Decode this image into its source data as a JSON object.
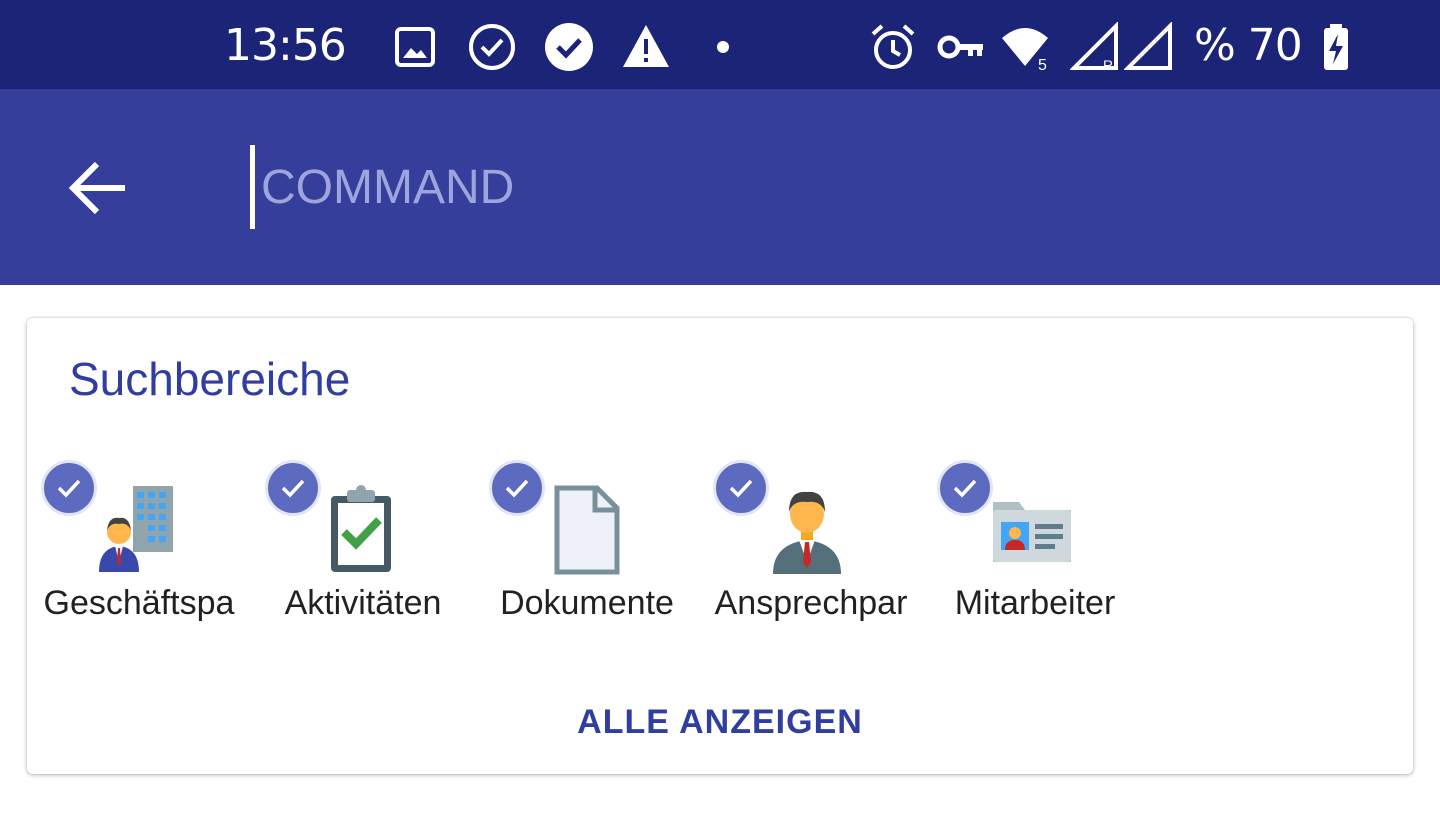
{
  "status_bar": {
    "time": "13:56",
    "battery_percent_text": "% 70",
    "icons_left": [
      "image-icon",
      "check-circle-outline-icon",
      "check-circle-filled-icon",
      "warning-icon",
      "dot-icon"
    ],
    "icons_right": [
      "alarm-icon",
      "vpn-key-icon",
      "wifi-5-icon",
      "signal-roaming-icon",
      "signal-icon",
      "battery-charging-icon"
    ]
  },
  "app_bar": {
    "back_icon": "arrow-back-icon",
    "search_placeholder": "COMMAND",
    "search_value": ""
  },
  "search_areas": {
    "title": "Suchbereiche",
    "items": [
      {
        "label": "Geschäftspa",
        "icon": "business-partner-icon",
        "checked": true
      },
      {
        "label": "Aktivitäten",
        "icon": "clipboard-check-icon",
        "checked": true
      },
      {
        "label": "Dokumente",
        "icon": "document-icon",
        "checked": true
      },
      {
        "label": "Ansprechpar",
        "icon": "contact-person-icon",
        "checked": true
      },
      {
        "label": "Mitarbeiter",
        "icon": "employee-card-icon",
        "checked": true
      }
    ],
    "show_all_label": "ALLE ANZEIGEN"
  },
  "colors": {
    "status_bar": "#1c2478",
    "app_bar": "#353f9b",
    "accent": "#303f9f",
    "check_badge": "#5c6bc0"
  }
}
